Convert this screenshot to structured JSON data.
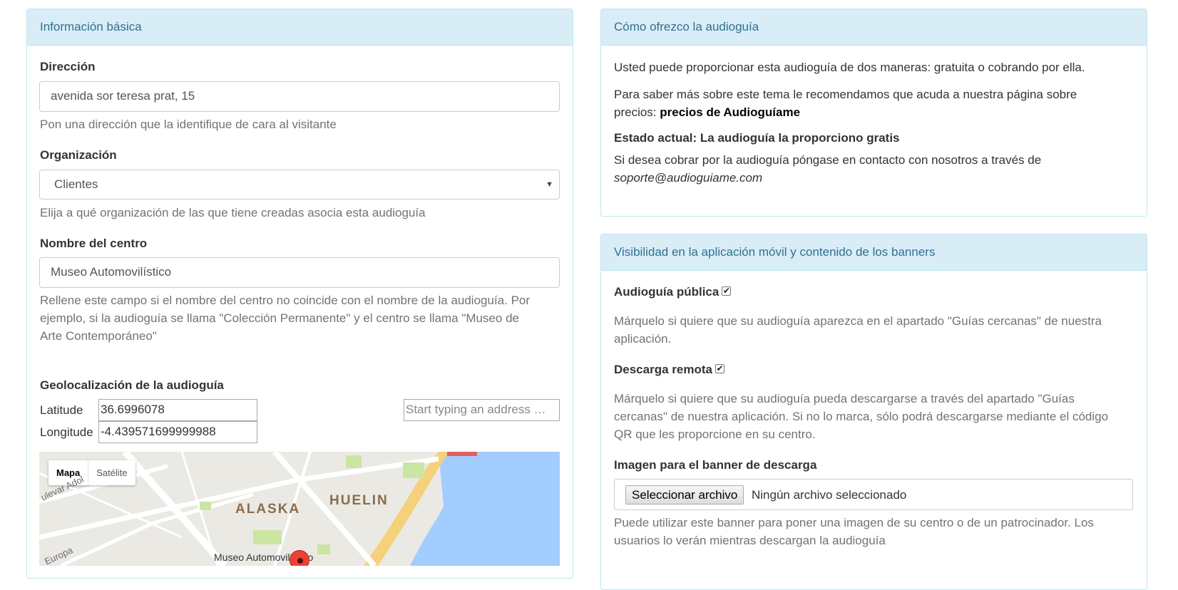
{
  "basic": {
    "heading": "Información básica",
    "address_label": "Dirección",
    "address_value": "avenida sor teresa prat, 15",
    "address_help": "Pon una dirección que la identifique de cara al visitante",
    "org_label": "Organización",
    "org_selected": "Clientes",
    "org_help": "Elija a qué organización de las que tiene creadas asocia esta audioguía",
    "center_label": "Nombre del centro",
    "center_value": "Museo Automovilístico",
    "center_help_1": "Rellene este campo si el nombre del centro no coincide con el nombre de la audioguía. Por",
    "center_help_2": "ejemplo, si la audioguía se llama \"Colección Permanente\" y el centro se llama \"Museo de",
    "center_help_3": "Arte Contemporáneo\"",
    "geo_label": "Geolocalización de la audioguía",
    "lat_label": "Latitude",
    "lat_value": "36.6996078",
    "lng_label": "Longitude",
    "lng_value": "-4.439571699999988",
    "address_search_placeholder": "Start typing an address …"
  },
  "map": {
    "map_button": "Mapa",
    "satellite_button": "Satélite",
    "area_alaska": "ALASKA",
    "area_huelin": "HUELIN",
    "street_1": "ulevar Adol",
    "street_2": "Europa",
    "marker_label": "Museo Automovilístico"
  },
  "offer": {
    "heading": "Cómo ofrezco la audioguía",
    "line_1": "Usted puede proporcionar esta audioguía de dos maneras: gratuita o cobrando por ella.",
    "line_2a": "Para saber más sobre este tema le recomendamos que acuda a nuestra página sobre",
    "line_2b_prefix": "precios: ",
    "line_2b_link": "precios de Audioguíame",
    "status": "Estado actual: La audioguía la proporciono gratis",
    "contact_1": "Si desea cobrar por la audioguía póngase en contacto con nosotros a través de",
    "contact_email": "soporte@audioguiame.com"
  },
  "visibility": {
    "heading": "Visibilidad en la aplicación móvil y contenido de los banners",
    "public_label": "Audioguía pública",
    "public_checked": true,
    "public_help_1": "Márquelo si quiere que su audioguía aparezca en el apartado \"Guías cercanas\" de nuestra",
    "public_help_2": "aplicación.",
    "remote_label": "Descarga remota",
    "remote_checked": true,
    "remote_help_1": "Márquelo si quiere que su audioguía pueda descargarse a través del apartado \"Guías",
    "remote_help_2": "cercanas\" de nuestra aplicación. Si no lo marca, sólo podrá descargarse mediante el código",
    "remote_help_3": "QR que les proporcione en su centro.",
    "banner_label": "Imagen para el banner de descarga",
    "file_button": "Seleccionar archivo",
    "file_status": "Ningún archivo seleccionado",
    "banner_help_1": "Puede utilizar este banner para poner una imagen de su centro o de un patrocinador. Los",
    "banner_help_2": "usuarios lo verán mientras descargan la audioguía"
  },
  "colors": {
    "panel_heading_bg": "#d9edf7",
    "panel_heading_text": "#31708f",
    "panel_border": "#bce8f1",
    "map_water": "#a3ccff",
    "marker": "#ea4335"
  }
}
